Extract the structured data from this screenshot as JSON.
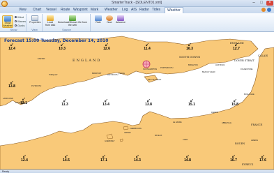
{
  "window": {
    "title": "SmarterTrack - [SOLENT01.xml]"
  },
  "menu": [
    "View",
    "Chart",
    "Vessel",
    "Route",
    "Waypoint",
    "Mark",
    "Weather",
    "Log",
    "AIS",
    "Radar",
    "Tides",
    "Weather"
  ],
  "ribbon": {
    "show_weather": "Show Weather",
    "options": [
      "Wind",
      "Waves",
      "Gusts"
    ],
    "properties": "Properties",
    "load_from_disk": "Load from disk",
    "download": "Download/Stream file from the web",
    "rate": "Rate",
    "now": "Now",
    "advance": "Advance",
    "group_show": "Show",
    "group_view": "View",
    "group_source": "Source"
  },
  "map": {
    "forecast_label": "Forecast 15:00 Tuesday, December 14, 2010",
    "wind_values": [
      "12.4",
      "10.3",
      "12.6",
      "11.4",
      "16.3",
      "12.7",
      "13.8",
      "12.1",
      "11.3",
      "13.4",
      "13.8",
      "15.1",
      "15.8",
      "12.4",
      "14.5",
      "17.1",
      "14.3",
      "14.8",
      "16.7",
      "17.6"
    ],
    "regions": {
      "england": "ENGLAND",
      "england_east": "ENGLAND",
      "south_downs": "SOUTH DOWNS",
      "dover_strait": "DOVER STRAIT",
      "calais": "CALAIS",
      "france": "FRANCE",
      "rouen": "ROUEN",
      "evreux": "EVREUX"
    },
    "places": [
      "EXETER",
      "BRIGHTON",
      "HASTINGS",
      "SOUTHAMPTON",
      "PORTSMOUTH",
      "PLYMOUTH",
      "FALMOUTH",
      "WEYMOUTH",
      "POOLE",
      "CHERBOURG",
      "LE HAVRE",
      "DIEPPE",
      "BOULOGNE",
      "CAEN",
      "BAYEUX",
      "BRIDPORT",
      "LANDS END",
      "TORQUAY",
      "ISLE OF WIGHT",
      "GUERNSEY",
      "JERSEY",
      "ABBEVILLE",
      "AMIENS",
      "BEACHY HEAD",
      "FOLKESTONE"
    ]
  },
  "status": {
    "text": "Ready"
  }
}
